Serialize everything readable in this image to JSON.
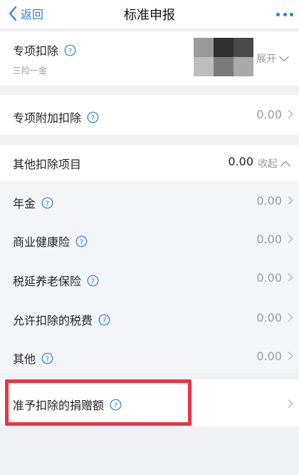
{
  "nav": {
    "back_label": "返回",
    "title": "标准申报"
  },
  "special_deduction": {
    "title": "专项扣除",
    "subtitle": "三险一金",
    "toggle_label": "展开"
  },
  "additional_deduction": {
    "title": "专项附加扣除",
    "value": "0.00"
  },
  "other_deduction": {
    "title": "其他扣除项目",
    "value": "0.00",
    "toggle_label": "收起",
    "items": [
      {
        "label": "年金",
        "value": "0.00"
      },
      {
        "label": "商业健康险",
        "value": "0.00"
      },
      {
        "label": "税延养老保险",
        "value": "0.00"
      },
      {
        "label": "允许扣除的税费",
        "value": "0.00"
      },
      {
        "label": "其他",
        "value": "0.00"
      }
    ]
  },
  "donation": {
    "title": "准予扣除的捐赠额"
  },
  "colors": {
    "accent": "#2a7de1",
    "highlight": "#e8344a",
    "muted_text": "#9b9b9b"
  }
}
